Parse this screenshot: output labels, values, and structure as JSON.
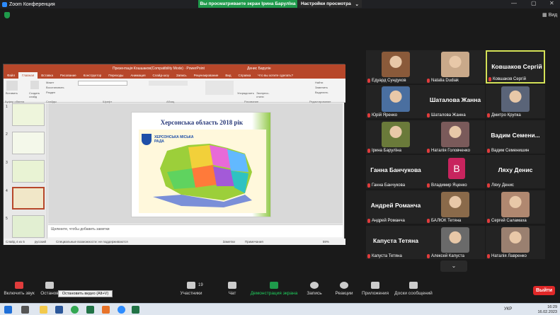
{
  "window": {
    "title": "Zoom Конференция",
    "view_label": "Вид"
  },
  "share": {
    "banner": "Вы просматриваете экран Ірина Барулїна",
    "settings": "Настройки просмотра"
  },
  "ppt": {
    "title": "Презентація Кошшаков(Compatibility Mode) · PowerPoint",
    "user": "Денис Барулін",
    "tabs": [
      "Файл",
      "Главная",
      "Вставка",
      "Рисование",
      "Конструктор",
      "Переходы",
      "Анимация",
      "Слайд-шоу",
      "Запись",
      "Рецензирование",
      "Вид",
      "Справка",
      "Что вы хотите сделать?"
    ],
    "active_tab": "Главная",
    "ribbon_groups": [
      "Буфер обмена",
      "Слайды",
      "Шрифт",
      "Абзац",
      "Рисование",
      "Редактирование"
    ],
    "ribbon_buttons": {
      "paste": "Вставить",
      "create_slide": "Создать слайд",
      "layout": "Макет",
      "reset": "Восстановить",
      "section": "Раздел",
      "arrange": "Упорядочить",
      "quick_styles": "Экспресс-стили",
      "find": "Найти",
      "replace": "Заменить",
      "select": "Выделить"
    },
    "thumb_numbers": [
      "1",
      "2",
      "3",
      "4",
      "5"
    ],
    "slide_title": "Херсонська область 2018 рік",
    "map_caption": "ХЕРСОНСЬКА МІСЬКА РАДА",
    "notes_placeholder": "Щелкните, чтобы добавить заметки",
    "status": {
      "slide": "Слайд 4 из 5",
      "lang": "русский",
      "accessibility": "Специальные возможности: не поддерживаются",
      "notes": "Заметки",
      "comments": "Примечания",
      "zoom": "59%"
    }
  },
  "participants": [
    {
      "name": "Едуард Сундуков",
      "display": "photo",
      "color": "#8a5a3a"
    },
    {
      "name": "Natalia Dudiak",
      "display": "photo",
      "color": "#c9a98a"
    },
    {
      "name": "Ковшаков Сергій",
      "display": "text",
      "active": true
    },
    {
      "name": "Юрій Яренко",
      "display": "photo",
      "color": "#4a6fa0"
    },
    {
      "name": "Шаталова Жанна",
      "display": "text"
    },
    {
      "name": "Дмитро Крупка",
      "display": "photo",
      "color": "#5a6478"
    },
    {
      "name": "Ірина Барулїна",
      "display": "photo",
      "color": "#6a7a3a"
    },
    {
      "name": "Наталія Головченко",
      "display": "photo",
      "color": "#7a5a5a"
    },
    {
      "name": "Вадим Семенишин",
      "big": "Вадим Семени...",
      "display": "text"
    },
    {
      "name": "Ганна Банчукова",
      "display": "text"
    },
    {
      "name": "Владимир Яценко",
      "display": "avatar",
      "letter": "В",
      "color": "#c8245e"
    },
    {
      "name": "Ляху Денис",
      "display": "text"
    },
    {
      "name": "Андрей Романча",
      "display": "text"
    },
    {
      "name": "БАЛЮК Тетяна",
      "display": "photo",
      "color": "#8a6a4a"
    },
    {
      "name": "Сергей Саламаха",
      "display": "photo",
      "color": "#b08870"
    },
    {
      "name": "Капуста Тетяна",
      "display": "text"
    },
    {
      "name": "Алексей Капуста",
      "display": "photo",
      "color": "#6a6a6a"
    },
    {
      "name": "Наталія Лавренко",
      "display": "photo",
      "color": "#9a8070"
    }
  ],
  "toolbar": {
    "mic": "Включить звук",
    "video": "Останов",
    "video_tooltip": "Остановить видео (Alt+V)",
    "participants": "Участники",
    "participants_count": "19",
    "chat": "Чат",
    "share": "Демонстрация экрана",
    "record": "Запись",
    "reactions": "Реакции",
    "apps": "Приложения",
    "whiteboard": "Доски сообщений",
    "leave": "Выйти"
  },
  "taskbar": {
    "lang": "УКР",
    "time": "16:29",
    "date": "16.02.2023",
    "notif": "2"
  },
  "colors": {
    "zoom_green": "#1f9a4b",
    "ppt_red": "#b7472a",
    "active_border": "#d4e157",
    "leave_red": "#e02828"
  }
}
